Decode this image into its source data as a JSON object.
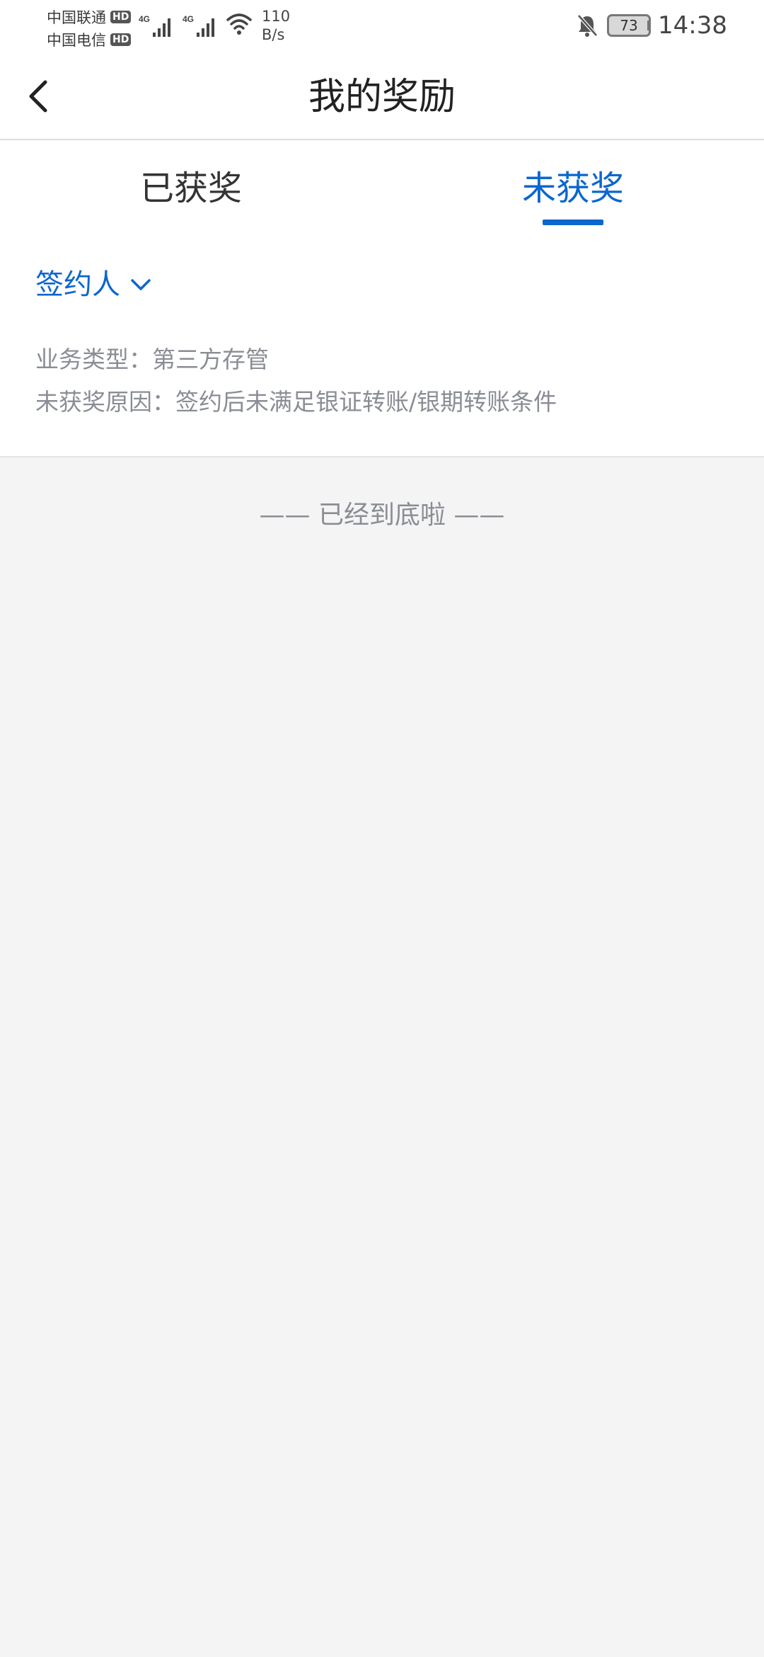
{
  "status_bar": {
    "carrier_1": "中国联通",
    "carrier_2": "中国电信",
    "hd_badge": "HD",
    "network_label": "4G",
    "net_speed_value": "110",
    "net_speed_unit": "B/s",
    "battery": "73",
    "time": "14:38"
  },
  "header": {
    "title": "我的奖励"
  },
  "tabs": [
    {
      "label": "已获奖",
      "active": false
    },
    {
      "label": "未获奖",
      "active": true
    }
  ],
  "card": {
    "role_label": "签约人",
    "business_type": "业务类型：第三方存管",
    "reason": "未获奖原因：签约后未满足银证转账/银期转账条件"
  },
  "footer": {
    "end_text": "—— 已经到底啦 ——"
  },
  "colors": {
    "accent": "#0b66cf",
    "background": "#f4f4f5",
    "muted_text": "#8a8d94"
  }
}
